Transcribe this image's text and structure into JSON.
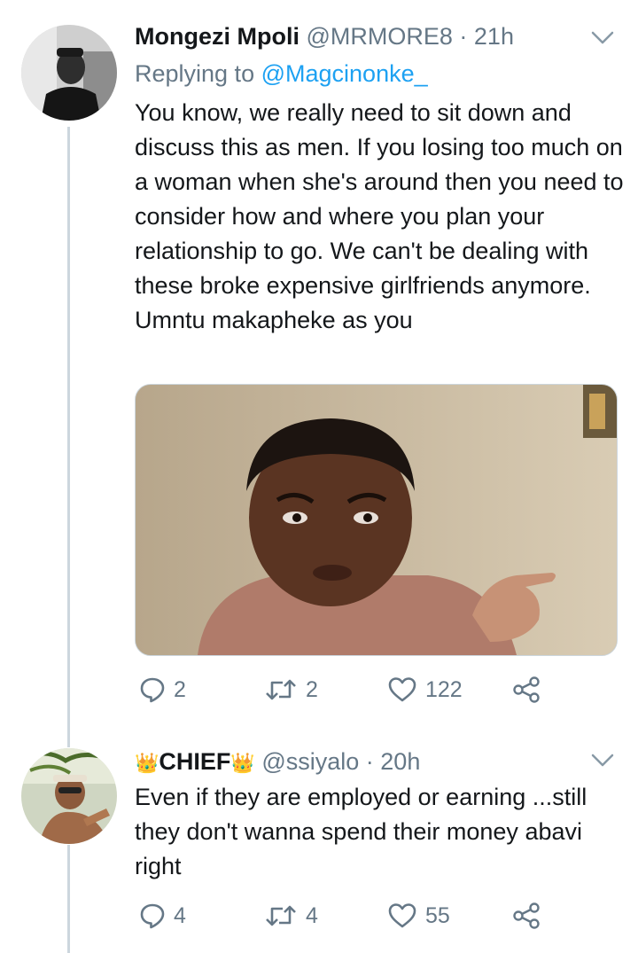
{
  "tweets": [
    {
      "name": "Mongezi Mpoli",
      "handle": "@MRMORE8",
      "time": "21h",
      "replying_label": "Replying to",
      "replying_handle": "@Magcinonke_",
      "text": "You know, we really need to sit down and discuss this as men. If you losing too much on a woman when she's around then you need to consider how and where you plan your relationship to go. We can't be dealing with these broke expensive girlfriends anymore. Umntu makapheke as you",
      "replies": "2",
      "retweets": "2",
      "likes": "122"
    },
    {
      "name": "CHIEF",
      "name_emoji_left": "👑",
      "name_emoji_right": "👑",
      "handle": "@ssiyalo",
      "time": "20h",
      "text": "Even if they are employed or earning ...still they don't wanna spend their money abavi right",
      "replies": "4",
      "retweets": "4",
      "likes": "55"
    }
  ],
  "separator": " · ",
  "icons": {
    "reply": "reply-icon",
    "retweet": "retweet-icon",
    "like": "heart-icon",
    "share": "share-icon",
    "caret": "chevron-down-icon",
    "crown": "crown-emoji"
  },
  "colors": {
    "text": "#14171a",
    "secondary": "#657786",
    "link": "#1da1f2",
    "line": "#ccd6dd"
  }
}
